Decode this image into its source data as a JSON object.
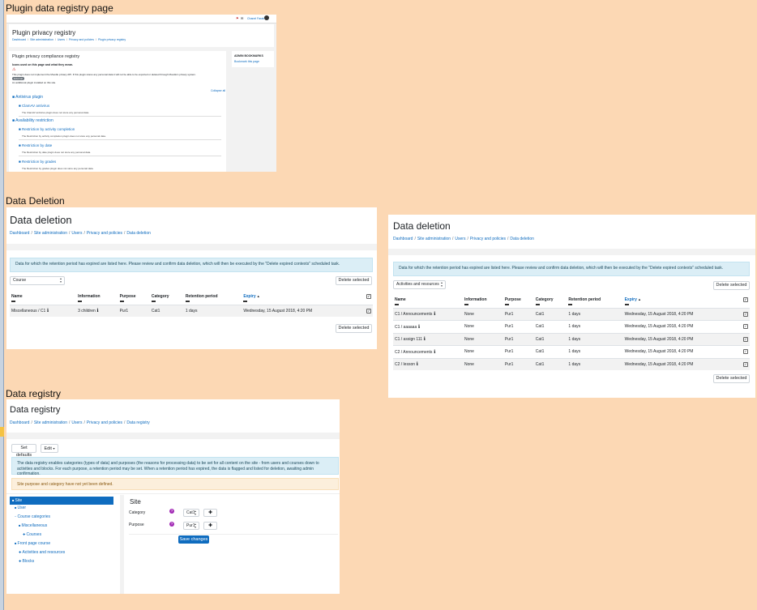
{
  "captions": {
    "plugin": "Plugin data registry page",
    "deletion": "Data Deletion",
    "registry": "Data registry"
  },
  "plugin_panel": {
    "nav_user": "Chanel Farah",
    "title": "Plugin privacy registry",
    "breadcrumb": [
      "Dashboard",
      "Site administration",
      "Users",
      "Privacy and policies",
      "Plugin privacy registry"
    ],
    "heading": "Plugin privacy compliance registry",
    "subheading": "Icons used on this page and what they mean.",
    "icon_note": "This plugin does not implement the Moodle privacy API. If this plugin stores any personal data it will not be able to be exported or deleted through Moodle's privacy system.",
    "badge": "External",
    "badge_note": "An additional plugin installed on this site.",
    "collapse": "Collapse all",
    "sidebar_title": "ADMIN BOOKMARKS",
    "sidebar_link": "Bookmark this page",
    "tree": [
      {
        "label": "Antivirus plugin",
        "level": 0
      },
      {
        "label": "ClamAV antivirus",
        "level": 1
      },
      {
        "label": "The ClamAV antivirus plugin does not store any personal data.",
        "level": 2
      },
      {
        "label": "Availability restriction",
        "level": 0
      },
      {
        "label": "Restriction by activity completion",
        "level": 1
      },
      {
        "label": "The Restriction by activity completion plugin does not store any personal data.",
        "level": 2
      },
      {
        "label": "Restriction by date",
        "level": 1
      },
      {
        "label": "The Restriction by date plugin does not store any personal data.",
        "level": 2
      },
      {
        "label": "Restriction by grades",
        "level": 1
      },
      {
        "label": "The Restriction by grades plugin does not store any personal data.",
        "level": 2
      }
    ]
  },
  "deletion1": {
    "title": "Data deletion",
    "breadcrumb": [
      "Dashboard",
      "Site administration",
      "Users",
      "Privacy and policies",
      "Data deletion"
    ],
    "info": "Data for which the retention period has expired are listed here. Please review and confirm data deletion, which will then be executed by the \"Delete expired contexts\" scheduled task.",
    "filter": "Course",
    "delete_label": "Delete selected",
    "columns": [
      "Name",
      "Information",
      "Purpose",
      "Category",
      "Retention period",
      "Expiry"
    ],
    "sort_arrow": "▲",
    "rows": [
      {
        "name": "Miscellaneous / C1",
        "info": "3 children",
        "purpose": "Pur1",
        "category": "Cat1",
        "retention": "1 days",
        "expiry": "Wednesday, 15 August 2018, 4:20 PM"
      }
    ]
  },
  "deletion2": {
    "title": "Data deletion",
    "breadcrumb": [
      "Dashboard",
      "Site administration",
      "Users",
      "Privacy and policies",
      "Data deletion"
    ],
    "info": "Data for which the retention period has expired are listed here. Please review and confirm data deletion, which will then be executed by the \"Delete expired contexts\" scheduled task.",
    "filter": "Activities and resources",
    "delete_label": "Delete selected",
    "columns": [
      "Name",
      "Information",
      "Purpose",
      "Category",
      "Retention period",
      "Expiry"
    ],
    "sort_arrow": "▲",
    "rows": [
      {
        "name": "C1 / Announcements",
        "info": "None",
        "purpose": "Pur1",
        "category": "Cat1",
        "retention": "1 days",
        "expiry": "Wednesday, 15 August 2018, 4:20 PM"
      },
      {
        "name": "C1 / aaaaaa",
        "info": "None",
        "purpose": "Pur1",
        "category": "Cat1",
        "retention": "1 days",
        "expiry": "Wednesday, 15 August 2018, 4:20 PM"
      },
      {
        "name": "C1 / assign 111",
        "info": "None",
        "purpose": "Pur1",
        "category": "Cat1",
        "retention": "1 days",
        "expiry": "Wednesday, 15 August 2018, 4:20 PM"
      },
      {
        "name": "C2 / Announcements",
        "info": "None",
        "purpose": "Pur1",
        "category": "Cat1",
        "retention": "1 days",
        "expiry": "Wednesday, 15 August 2018, 4:20 PM"
      },
      {
        "name": "C2 / lesson",
        "info": "None",
        "purpose": "Pur1",
        "category": "Cat1",
        "retention": "1 days",
        "expiry": "Wednesday, 15 August 2018, 4:20 PM"
      }
    ]
  },
  "registry": {
    "title": "Data registry",
    "breadcrumb": [
      "Dashboard",
      "Site administration",
      "Users",
      "Privacy and policies",
      "Data registry"
    ],
    "set_defaults": "Set defaults",
    "edit": "Edit",
    "info": "The data registry enables categories (types of data) and purposes (the reasons for processing data) to be set for all content on the site - from users and courses down to activities and blocks. For each purpose, a retention period may be set. When a retention period has expired, the data is flagged and listed for deletion, awaiting admin confirmation.",
    "warning": "Site purpose and category have not yet been defined.",
    "tree": [
      {
        "label": "Site",
        "level": 0,
        "selected": true
      },
      {
        "label": "User",
        "level": 1
      },
      {
        "label": "Course categories",
        "level": 1
      },
      {
        "label": "Miscellaneous",
        "level": 2
      },
      {
        "label": "Courses",
        "level": 3
      },
      {
        "label": "Front page course",
        "level": 1
      },
      {
        "label": "Activities and resources",
        "level": 2
      },
      {
        "label": "Blocks",
        "level": 2
      }
    ],
    "detail_title": "Site",
    "category_label": "Category",
    "category_value": "Cat1",
    "purpose_label": "Purpose",
    "purpose_value": "Pur1",
    "save": "Save changes"
  },
  "colors": {
    "background": "#fcd8b4",
    "link": "#0f6cbf",
    "primary": "#0f6cbf",
    "info_bg": "#dbeef6",
    "warning_bg": "#fcefdc"
  }
}
